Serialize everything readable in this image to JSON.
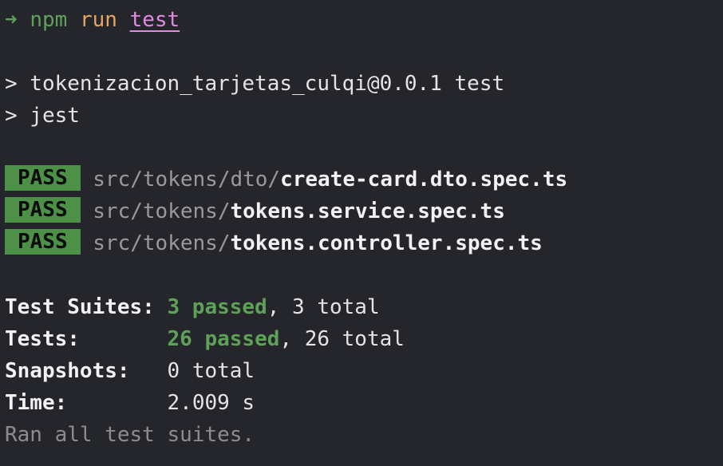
{
  "command": {
    "arrow": "➜",
    "program": "npm",
    "subcommand": "run",
    "script": "test"
  },
  "npm_output": {
    "line1": "> tokenizacion_tarjetas_culqi@0.0.1 test",
    "line2": "> jest"
  },
  "results": [
    {
      "status": "PASS",
      "dir": "src/tokens/dto/",
      "file": "create-card.dto.spec.ts"
    },
    {
      "status": "PASS",
      "dir": "src/tokens/",
      "file": "tokens.service.spec.ts"
    },
    {
      "status": "PASS",
      "dir": "src/tokens/",
      "file": "tokens.controller.spec.ts"
    }
  ],
  "summary": {
    "suites_label": "Test Suites:",
    "suites_passed": "3 passed",
    "suites_total": ", 3 total",
    "tests_label": "Tests:",
    "tests_passed": "26 passed",
    "tests_total": ", 26 total",
    "snapshots_label": "Snapshots:",
    "snapshots_value": "0 total",
    "time_label": "Time:",
    "time_value": "2.009 s",
    "footer": "Ran all test suites."
  },
  "colors": {
    "background": "#25262b",
    "pass_badge": "#4d9148",
    "green": "#5ea25a",
    "orange": "#e5a562",
    "magenta": "#e08ae0"
  }
}
